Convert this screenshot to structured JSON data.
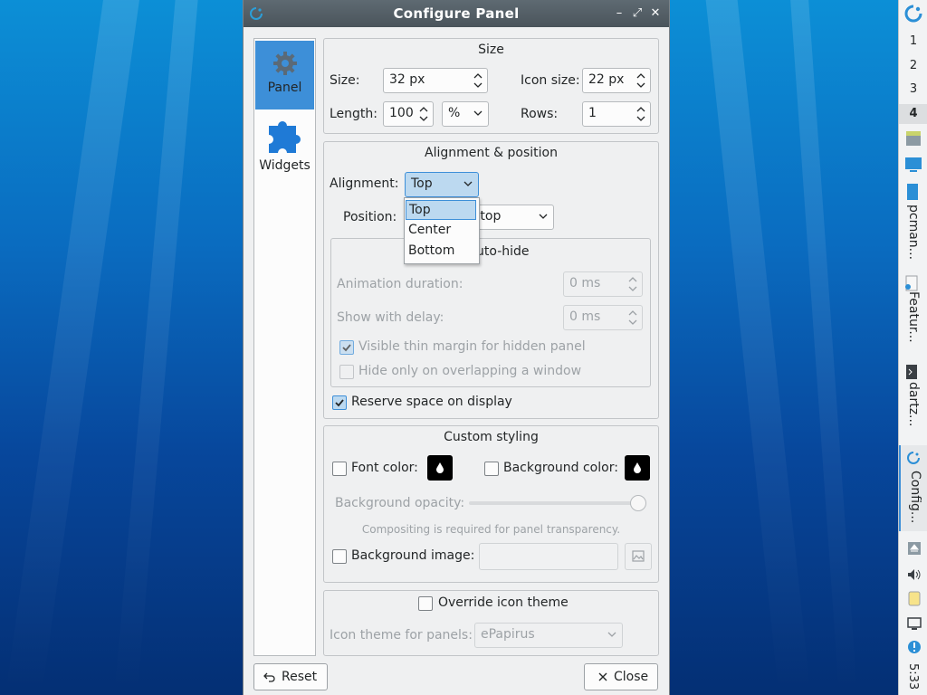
{
  "window": {
    "title": "Configure Panel",
    "buttons": {
      "minimize": "–",
      "maximize": "⤢",
      "close": "✕"
    }
  },
  "sidebar": {
    "items": [
      {
        "label": "Panel",
        "icon": "gear-icon",
        "selected": true
      },
      {
        "label": "Widgets",
        "icon": "puzzle-icon",
        "selected": false
      }
    ]
  },
  "size_group": {
    "title": "Size",
    "size_label": "Size:",
    "size_value": "32 px",
    "icon_size_label": "Icon size:",
    "icon_size_value": "22 px",
    "length_label": "Length:",
    "length_value": "100",
    "length_unit": "%",
    "rows_label": "Rows:",
    "rows_value": "1"
  },
  "alignment_group": {
    "title": "Alignment & position",
    "alignment_label": "Alignment:",
    "alignment_value": "Top",
    "alignment_options": [
      "Top",
      "Center",
      "Bottom"
    ],
    "position_label": "Position:",
    "position_value_visible": "sktop",
    "autohide_label_visible": "uto-hide",
    "animation_label": "Animation duration:",
    "animation_value": "0 ms",
    "delay_label": "Show with delay:",
    "delay_value": "0 ms",
    "thin_margin_label": "Visible thin margin for hidden panel",
    "thin_margin_checked": true,
    "overlap_label": "Hide only on overlapping a window",
    "overlap_checked": false,
    "reserve_label": "Reserve space on display",
    "reserve_checked": true
  },
  "styling_group": {
    "title": "Custom styling",
    "font_color_label": "Font color:",
    "bg_color_label": "Background color:",
    "opacity_label": "Background opacity:",
    "opacity_level": 1.0,
    "compositing_note": "Compositing is required for panel transparency.",
    "bg_image_label": "Background image:"
  },
  "icon_theme_group": {
    "override_label": "Override icon theme",
    "theme_label": "Icon theme for panels:",
    "theme_value": "ePapirus"
  },
  "footer": {
    "reset_label": "Reset",
    "close_label": "Close"
  },
  "taskbar": {
    "desktops": [
      "1",
      "2",
      "3",
      "4"
    ],
    "active_desktop": "4",
    "tasks": [
      "pcman...",
      "Featur...",
      "dartz...",
      "Config..."
    ],
    "clock": "5:33"
  },
  "colors": {
    "accent": "#3d8fd8",
    "selection": "#bcd9f0",
    "window_bg": "#eff0f1",
    "titlebar": "#4a545b"
  }
}
